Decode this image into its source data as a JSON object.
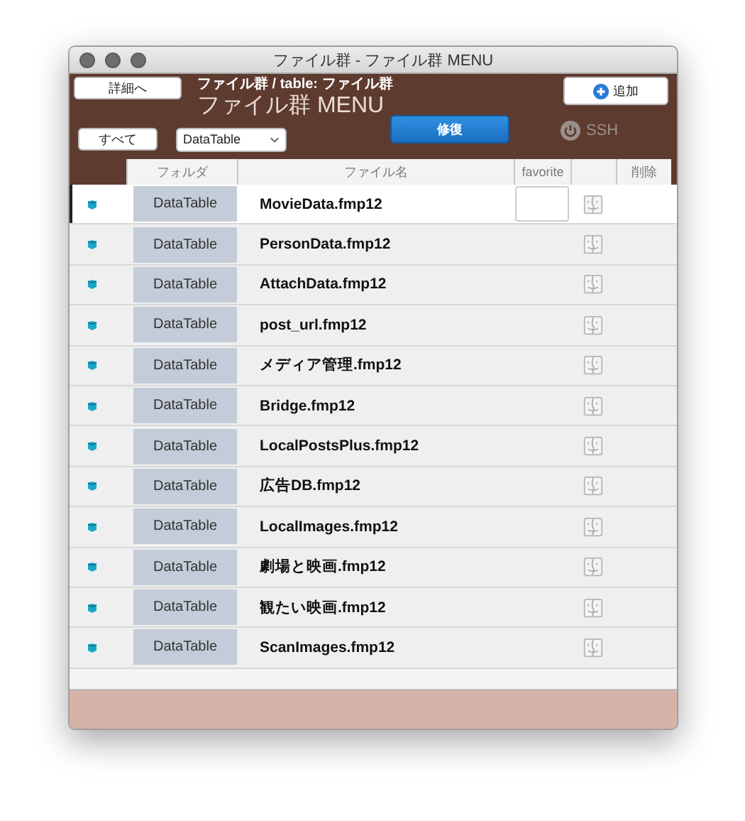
{
  "window": {
    "title": "ファイル群 - ファイル群 MENU"
  },
  "header": {
    "detail_button": "詳細へ",
    "breadcrumb": "ファイル群 / table: ファイル群",
    "heading": "ファイル群 MENU",
    "add_button": "追加",
    "all_button": "すべて",
    "folder_dropdown": {
      "value": "DataTable"
    },
    "repair_button": "修復",
    "ssh_toggle": {
      "label": "SSH",
      "on": false
    }
  },
  "table": {
    "columns": [
      "フォルダ",
      "ファイル名",
      "favorite",
      "削除"
    ],
    "rows": [
      {
        "folder": "DataTable",
        "file": "MovieData.fmp12",
        "selected": true
      },
      {
        "folder": "DataTable",
        "file": "PersonData.fmp12",
        "selected": false
      },
      {
        "folder": "DataTable",
        "file": "AttachData.fmp12",
        "selected": false
      },
      {
        "folder": "DataTable",
        "file": "post_url.fmp12",
        "selected": false
      },
      {
        "folder": "DataTable",
        "file": "メディア管理.fmp12",
        "selected": false
      },
      {
        "folder": "DataTable",
        "file": "Bridge.fmp12",
        "selected": false
      },
      {
        "folder": "DataTable",
        "file": "LocalPostsPlus.fmp12",
        "selected": false
      },
      {
        "folder": "DataTable",
        "file": "広告DB.fmp12",
        "selected": false
      },
      {
        "folder": "DataTable",
        "file": "LocalImages.fmp12",
        "selected": false
      },
      {
        "folder": "DataTable",
        "file": "劇場と映画.fmp12",
        "selected": false
      },
      {
        "folder": "DataTable",
        "file": "観たい映画.fmp12",
        "selected": false
      },
      {
        "folder": "DataTable",
        "file": "ScanImages.fmp12",
        "selected": false
      }
    ]
  }
}
